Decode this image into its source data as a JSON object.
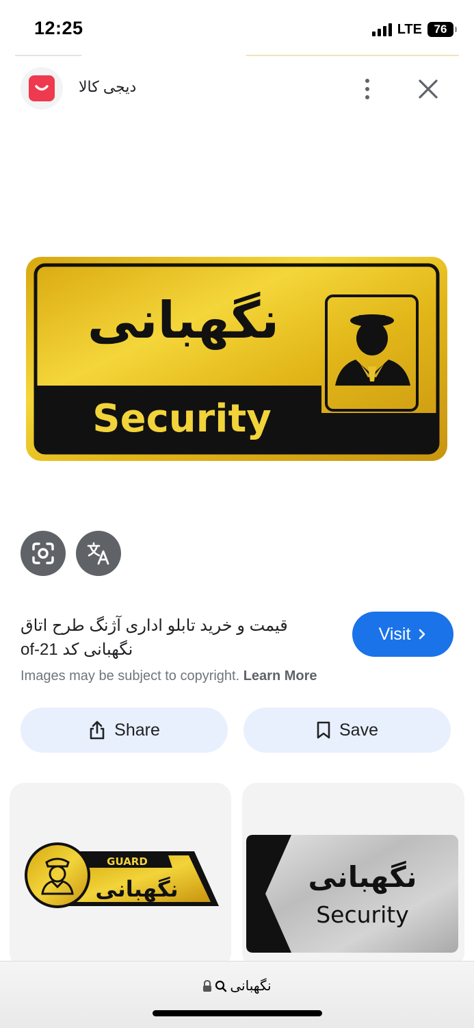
{
  "status": {
    "time": "12:25",
    "network": "LTE",
    "battery": "76"
  },
  "source": {
    "name": "دیجی کالا",
    "logo_icon": "digikala-logo-icon",
    "brand_color": "#ef394e"
  },
  "main_image": {
    "sign_persian": "نگهبانی",
    "sign_english": "Security",
    "icon": "security-guard-icon"
  },
  "actions": {
    "lens_icon": "google-lens-icon",
    "translate_icon": "translate-icon"
  },
  "result": {
    "title": "قیمت و خرید تابلو اداری آژنگ طرح اتاق نگهبانی کد of-21",
    "visit_label": "Visit",
    "copyright_text": "Images may be subject to copyright.",
    "learn_more": "Learn More"
  },
  "buttons": {
    "share_label": "Share",
    "save_label": "Save"
  },
  "related": [
    {
      "badge": "GUARD",
      "persian": "نگهبانی"
    },
    {
      "persian": "نگهبانی",
      "english": "Security"
    }
  ],
  "browser": {
    "url_text": "نگهبانی"
  },
  "colors": {
    "accent": "#1a73e8",
    "pill_bg": "#e8f0fe",
    "gold": "#e8c22a"
  }
}
